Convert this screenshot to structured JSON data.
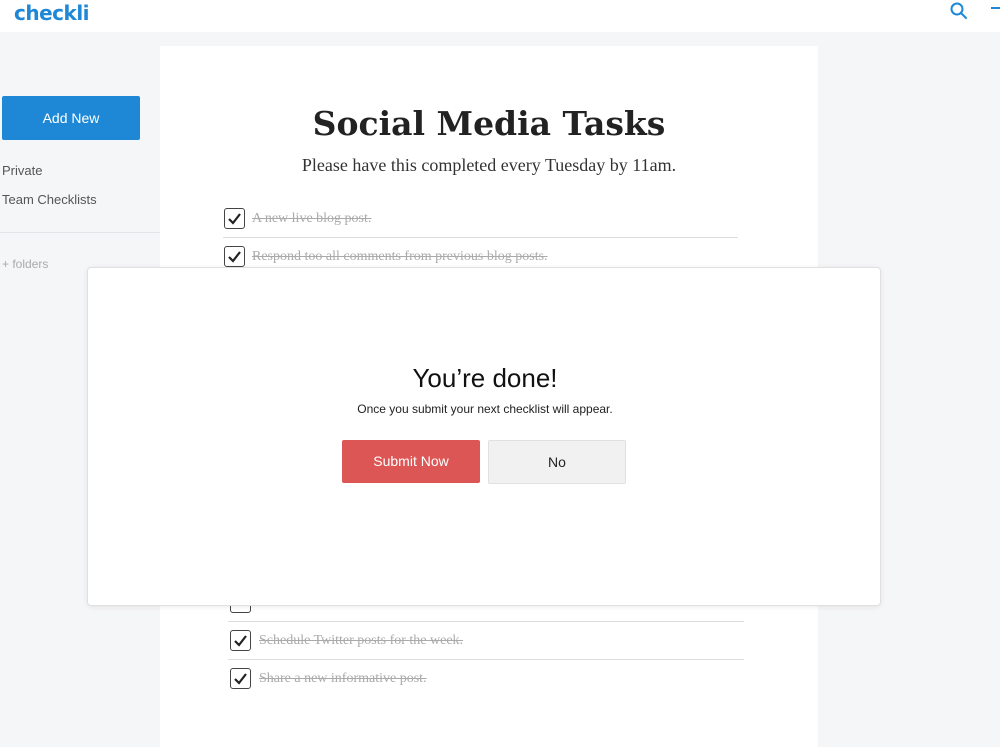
{
  "app": {
    "logo": "checkli"
  },
  "header": {
    "icons": [
      "search-icon",
      "menu-icon"
    ],
    "accent_color": "#1e88d6"
  },
  "sidebar": {
    "add_new_label": "Add New",
    "items": [
      {
        "label": "Private"
      },
      {
        "label": "Team Checklists"
      }
    ],
    "folders_label": "+ folders"
  },
  "checklist": {
    "title": "Social Media Tasks",
    "subtitle": "Please have this completed every Tuesday by 11am.",
    "tasks": [
      {
        "text": "A new live blog post.",
        "checked": true
      },
      {
        "text": "Respond too all comments from previous blog posts.",
        "checked": true
      },
      {
        "text": "Schedule Twitter posts for the week.",
        "checked": true
      },
      {
        "text": "Share a new informative post.",
        "checked": true
      }
    ]
  },
  "modal": {
    "title": "You’re done!",
    "message": "Once you submit your next checklist will appear.",
    "submit_label": "Submit Now",
    "no_label": "No",
    "submit_color": "#db5654"
  }
}
